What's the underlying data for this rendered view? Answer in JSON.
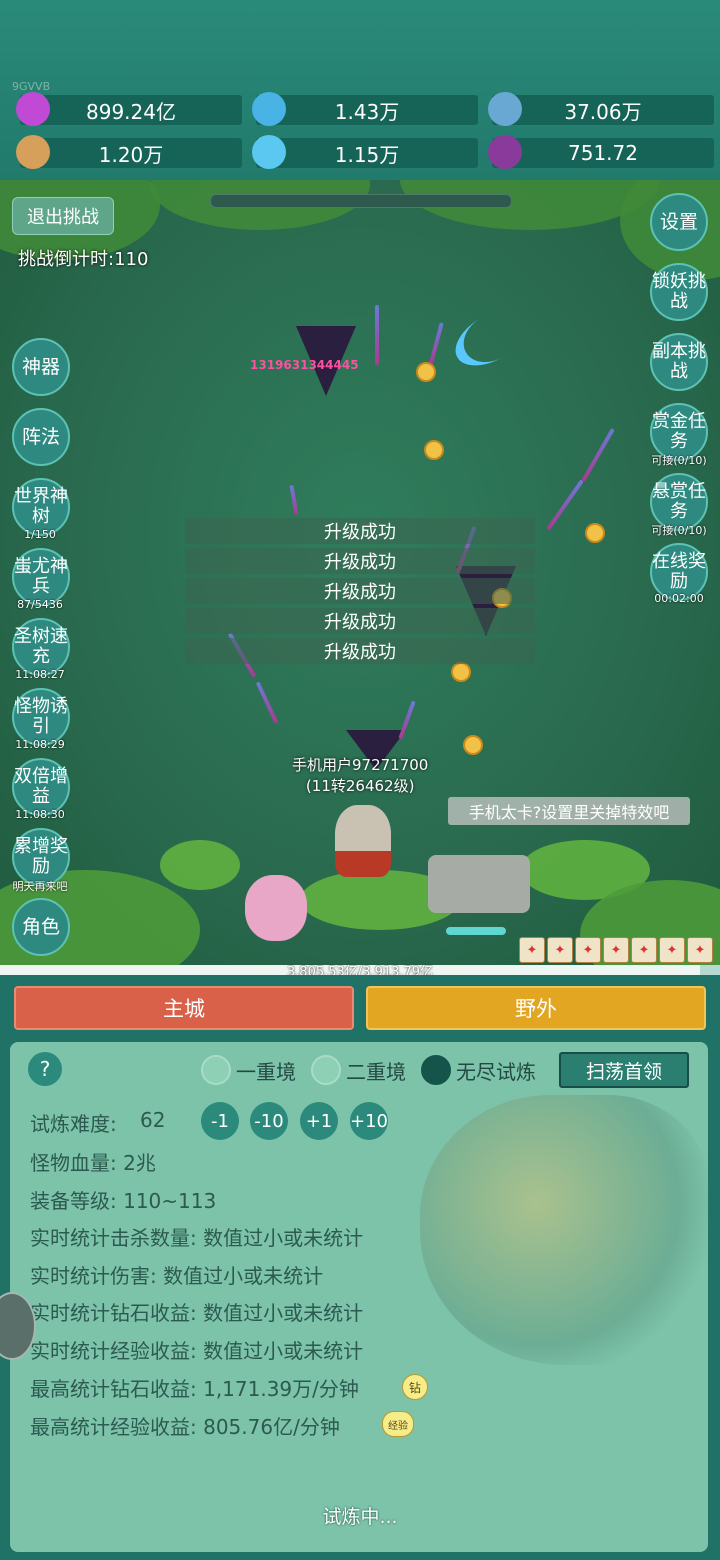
{
  "header": {
    "tag": "9GVVB",
    "resources": [
      {
        "icon": "purple-gem-icon",
        "value": "899.24亿",
        "color": "#c04ad6"
      },
      {
        "icon": "blue-crystal-icon",
        "value": "1.43万",
        "color": "#4ab3e6"
      },
      {
        "icon": "orb-icon",
        "value": "37.06万",
        "color": "#6aa8d4"
      },
      {
        "icon": "book-icon",
        "value": "1.20万",
        "color": "#d6a05a"
      },
      {
        "icon": "ice-crystal-icon",
        "value": "1.15万",
        "color": "#5ac8f0"
      },
      {
        "icon": "potion-icon",
        "value": "751.72",
        "color": "#8a3a9a"
      }
    ]
  },
  "battle": {
    "exit_label": "退出挑战",
    "countdown": "挑战倒计时:110",
    "damage_number": "1319631344445",
    "float_texts": [
      "升级成功",
      "升级成功",
      "升级成功",
      "升级成功",
      "升级成功"
    ],
    "player_name": "手机用户97271700",
    "player_level": "(11转26462级)",
    "tip": "手机太卡?设置里关掉特效吧",
    "exp_text": "3,805.53亿/3,913.79亿",
    "exp_fraction": 0.972
  },
  "left_buttons": [
    {
      "label": "神器",
      "sub": ""
    },
    {
      "label": "阵法",
      "sub": ""
    },
    {
      "label": "世界神树",
      "sub": "1/150"
    },
    {
      "label": "蚩尤神兵",
      "sub": "87/5436"
    },
    {
      "label": "圣树速充",
      "sub": "11:08:27"
    },
    {
      "label": "怪物诱引",
      "sub": "11:08:29"
    },
    {
      "label": "双倍增益",
      "sub": "11:08:30"
    },
    {
      "label": "累增奖励",
      "sub": "明天再来吧"
    },
    {
      "label": "角色",
      "sub": ""
    }
  ],
  "right_buttons": [
    {
      "label": "设置",
      "sub": ""
    },
    {
      "label": "锁妖挑战",
      "sub": ""
    },
    {
      "label": "副本挑战",
      "sub": ""
    },
    {
      "label": "赏金任务",
      "sub": "可接(0/10)"
    },
    {
      "label": "悬赏任务",
      "sub": "可接(0/10)"
    },
    {
      "label": "在线奖励",
      "sub": "00:02:00"
    }
  ],
  "nav": {
    "main_city": "主城",
    "wild": "野外"
  },
  "trial": {
    "help": "?",
    "modes": [
      "一重境",
      "二重境",
      "无尽试炼"
    ],
    "selected_mode": "无尽试炼",
    "sweep_label": "扫荡首领",
    "difficulty_label": "试炼难度:",
    "difficulty_value": "62",
    "diff_buttons": [
      "-1",
      "-10",
      "+1",
      "+10"
    ],
    "lines": [
      "怪物血量: 2兆",
      "装备等级: 110~113",
      "实时统计击杀数量: 数值过小或未统计",
      "实时统计伤害: 数值过小或未统计",
      "实时统计钻石收益: 数值过小或未统计",
      "实时统计经验收益: 数值过小或未统计",
      "最高统计钻石收益: 1,171.39万/分钟",
      "最高统计经验收益: 805.76亿/分钟"
    ],
    "badge_diamond": "钻",
    "badge_exp": "经验",
    "status": "试炼中..."
  }
}
